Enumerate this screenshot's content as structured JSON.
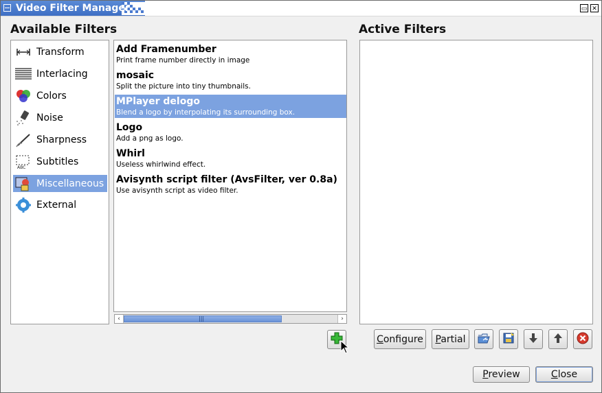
{
  "window": {
    "title": "Video Filter Manager",
    "minimize_glyph": "▭",
    "close_glyph": "✕"
  },
  "available": {
    "heading": "Available Filters",
    "categories": [
      {
        "label": "Transform",
        "icon": "transform-icon"
      },
      {
        "label": "Interlacing",
        "icon": "interlacing-icon"
      },
      {
        "label": "Colors",
        "icon": "colors-icon"
      },
      {
        "label": "Noise",
        "icon": "noise-icon"
      },
      {
        "label": "Sharpness",
        "icon": "sharpness-icon"
      },
      {
        "label": "Subtitles",
        "icon": "subtitles-icon"
      },
      {
        "label": "Miscellaneous",
        "icon": "miscellaneous-icon",
        "selected": true
      },
      {
        "label": "External",
        "icon": "external-icon"
      }
    ],
    "filters": [
      {
        "name": "Add Framenumber",
        "desc": "Print frame number directly in image"
      },
      {
        "name": "mosaic",
        "desc": "Split the picture into tiny thumbnails."
      },
      {
        "name": "MPlayer delogo",
        "desc": "Blend a logo by interpolating its surrounding box.",
        "selected": true
      },
      {
        "name": "Logo",
        "desc": "Add a png as logo."
      },
      {
        "name": "Whirl",
        "desc": "Useless whirlwind effect."
      },
      {
        "name": "Avisynth script filter (AvsFilter, ver 0.8a)",
        "desc": "Use avisynth script as video filter."
      }
    ],
    "scrollbar": {
      "left_arrow": "‹",
      "right_arrow": "›",
      "grip": "|||"
    }
  },
  "active": {
    "heading": "Active Filters",
    "buttons": {
      "configure": "Configure",
      "partial": "Partial"
    }
  },
  "footer": {
    "preview": "Preview",
    "close": "Close"
  },
  "colors": {
    "selection": "#7ca2e0",
    "titlebar": "#4a7bd0"
  }
}
